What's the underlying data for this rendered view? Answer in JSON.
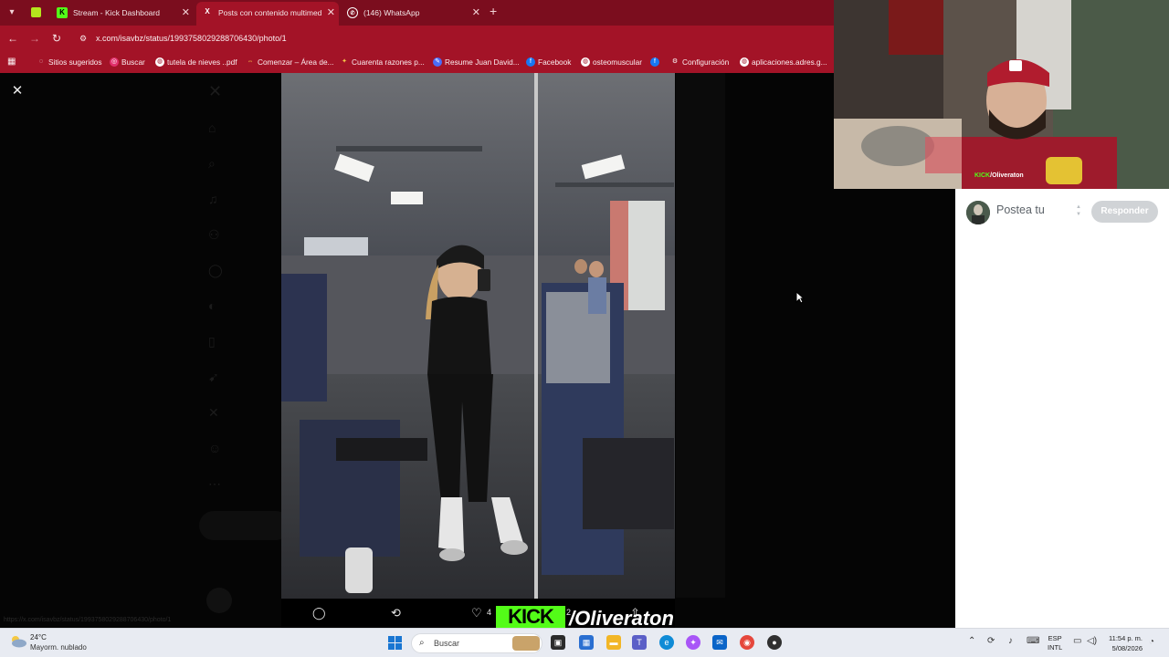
{
  "browser": {
    "tabs": [
      {
        "title": "Stream - Kick Dashboard",
        "icon": "kick-icon"
      },
      {
        "title": "Posts con contenido multimed",
        "icon": "x-icon"
      },
      {
        "title": "(146) WhatsApp",
        "icon": "whatsapp-icon"
      }
    ],
    "url": "x.com/isavbz/status/1993758029288706430/photo/1",
    "bookmarks": [
      {
        "label": "Sitios sugeridos"
      },
      {
        "label": "Buscar"
      },
      {
        "label": "tutela de nieves ..pdf"
      },
      {
        "label": "Comenzar – Área de..."
      },
      {
        "label": "Cuarenta razones p..."
      },
      {
        "label": "Resume Juan David..."
      },
      {
        "label": "Facebook"
      },
      {
        "label": "osteomuscular"
      },
      {
        "label": "Configuración"
      },
      {
        "label": "aplicaciones.adres.g..."
      }
    ]
  },
  "x": {
    "post_actions": {
      "likes": "4",
      "views": "2"
    }
  },
  "stream": {
    "brand": "KICK",
    "handle": "/Oliveraton",
    "cam_handle": "/Oliveraton"
  },
  "reply": {
    "placeholder": "Postea tu",
    "button": "Responder"
  },
  "taskbar": {
    "temperature": "24°C",
    "weather": "Mayorm. nublado",
    "search_placeholder": "Buscar",
    "language": "ESP",
    "layout": "INTL",
    "time": "11:54 p. m.",
    "date": "5/08/2026"
  },
  "colors": {
    "chrome_dark": "#7b0d1e",
    "chrome": "#a31327",
    "kick_green": "#53fc18",
    "reply_button": "#d0d3d6"
  }
}
